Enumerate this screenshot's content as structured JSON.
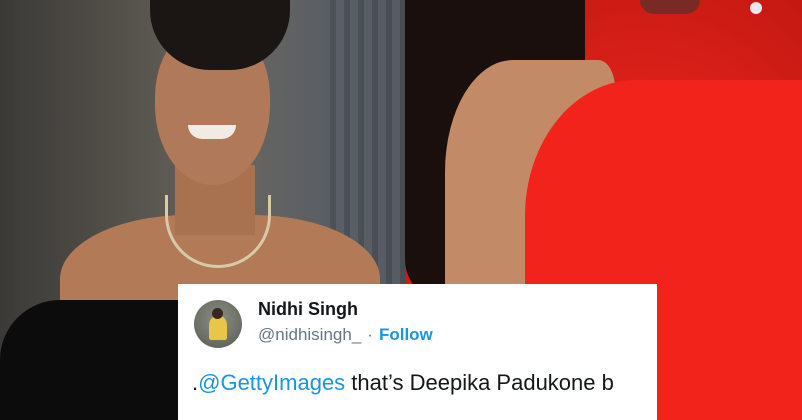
{
  "tweet": {
    "name": "Nidhi Singh",
    "handle": "@nidhisingh_",
    "separator": "·",
    "follow_label": "Follow",
    "text_prefix": ".",
    "mention": "@GettyImages",
    "text_rest": " that’s Deepika Padukone b"
  },
  "colors": {
    "link": "#1b95e0",
    "text": "#14171a",
    "muted": "#657786",
    "dress_red": "#f2231a"
  }
}
